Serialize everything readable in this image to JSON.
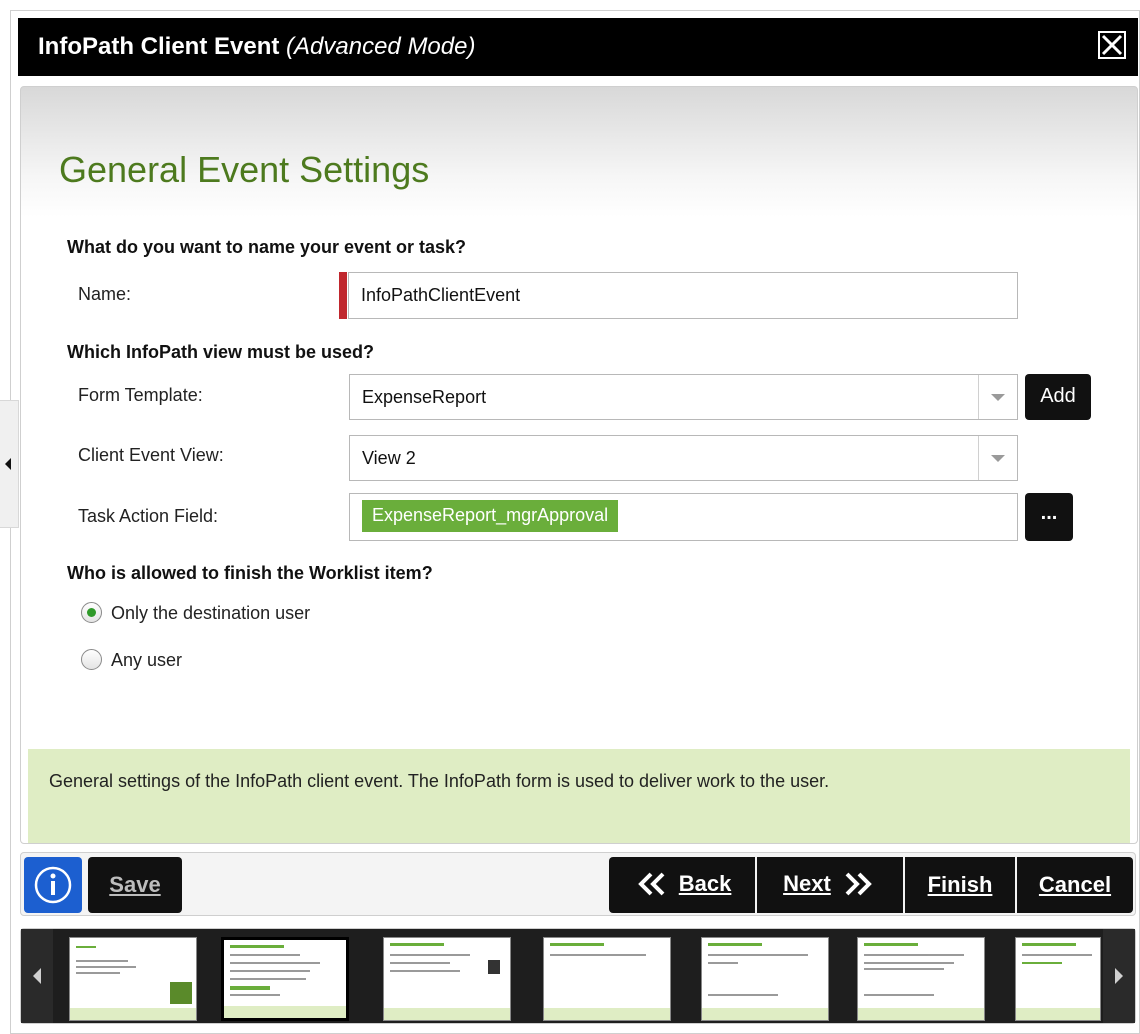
{
  "dialog": {
    "title": "InfoPath Client Event",
    "mode": "(Advanced Mode)"
  },
  "page": {
    "heading": "General Event Settings",
    "q_name": "What do you want to name your event or task?",
    "name_label": "Name:",
    "name_value": "InfoPathClientEvent",
    "q_view": "Which InfoPath view must be used?",
    "form_template_label": "Form Template:",
    "form_template_value": "ExpenseReport",
    "add_label": "Add",
    "client_view_label": "Client Event View:",
    "client_view_value": "View 2",
    "task_action_label": "Task Action Field:",
    "task_action_value": "ExpenseReport_mgrApproval",
    "browse_label": "...",
    "q_finish": "Who is allowed to finish the Worklist item?",
    "radio_only": "Only the destination user",
    "radio_any": "Any user",
    "radio_selected": "Only the destination user",
    "info_text": "General settings of the InfoPath client event. The InfoPath form is used to deliver work to the user."
  },
  "toolbar": {
    "save_label": "Save",
    "back_label": "Back",
    "next_label": "Next",
    "finish_label": "Finish",
    "cancel_label": "Cancel"
  },
  "colors": {
    "accent_green": "#6aae3b",
    "heading_green": "#4d7a1e",
    "info_bg": "#dfedc4",
    "required_red": "#c0272d",
    "info_button_blue": "#1c5fd0"
  },
  "icons": [
    "close-icon",
    "info-icon",
    "back-chevrons-icon",
    "next-chevrons-icon",
    "dropdown-arrow-icon",
    "scroll-left-icon",
    "scroll-right-icon"
  ]
}
